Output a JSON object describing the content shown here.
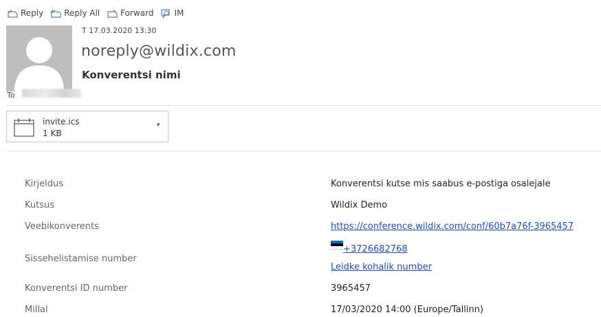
{
  "toolbar": {
    "reply": "Reply",
    "reply_all": "Reply All",
    "forward": "Forward",
    "im": "IM",
    "icon_color": "#5b7db1"
  },
  "header": {
    "date": "T 17.03.2020 13:30",
    "sender": "noreply@wildix.com",
    "subject": "Konverentsi nimi",
    "to_label": "To"
  },
  "attachment": {
    "name": "invite.ics",
    "size": "1 KB",
    "icon": "calendar-icon"
  },
  "details": [
    {
      "label": "Kirjeldus",
      "value": "Konverentsi kutse mis saabus e-postiga osalejale"
    },
    {
      "label": "Kutsus",
      "value": "Wildix Demo"
    },
    {
      "label": "Veebikonverents",
      "value": "https://conference.wildix.com/conf/60b7a76f-3965457"
    },
    {
      "label": "Sissehelistamise number",
      "phone": "+3726682768",
      "local_link": "Leidke kohalik number"
    },
    {
      "label": "Konverentsi ID number",
      "value": "3965457"
    },
    {
      "label": "Millal",
      "value": "17/03/2020 14:00 (Europe/Tallinn)"
    }
  ],
  "colors": {
    "link": "#1a4ad8",
    "avatar_bg": "#bebebe",
    "flag_blue": "#0072ce",
    "flag_black": "#000000",
    "flag_white": "#ffffff"
  }
}
